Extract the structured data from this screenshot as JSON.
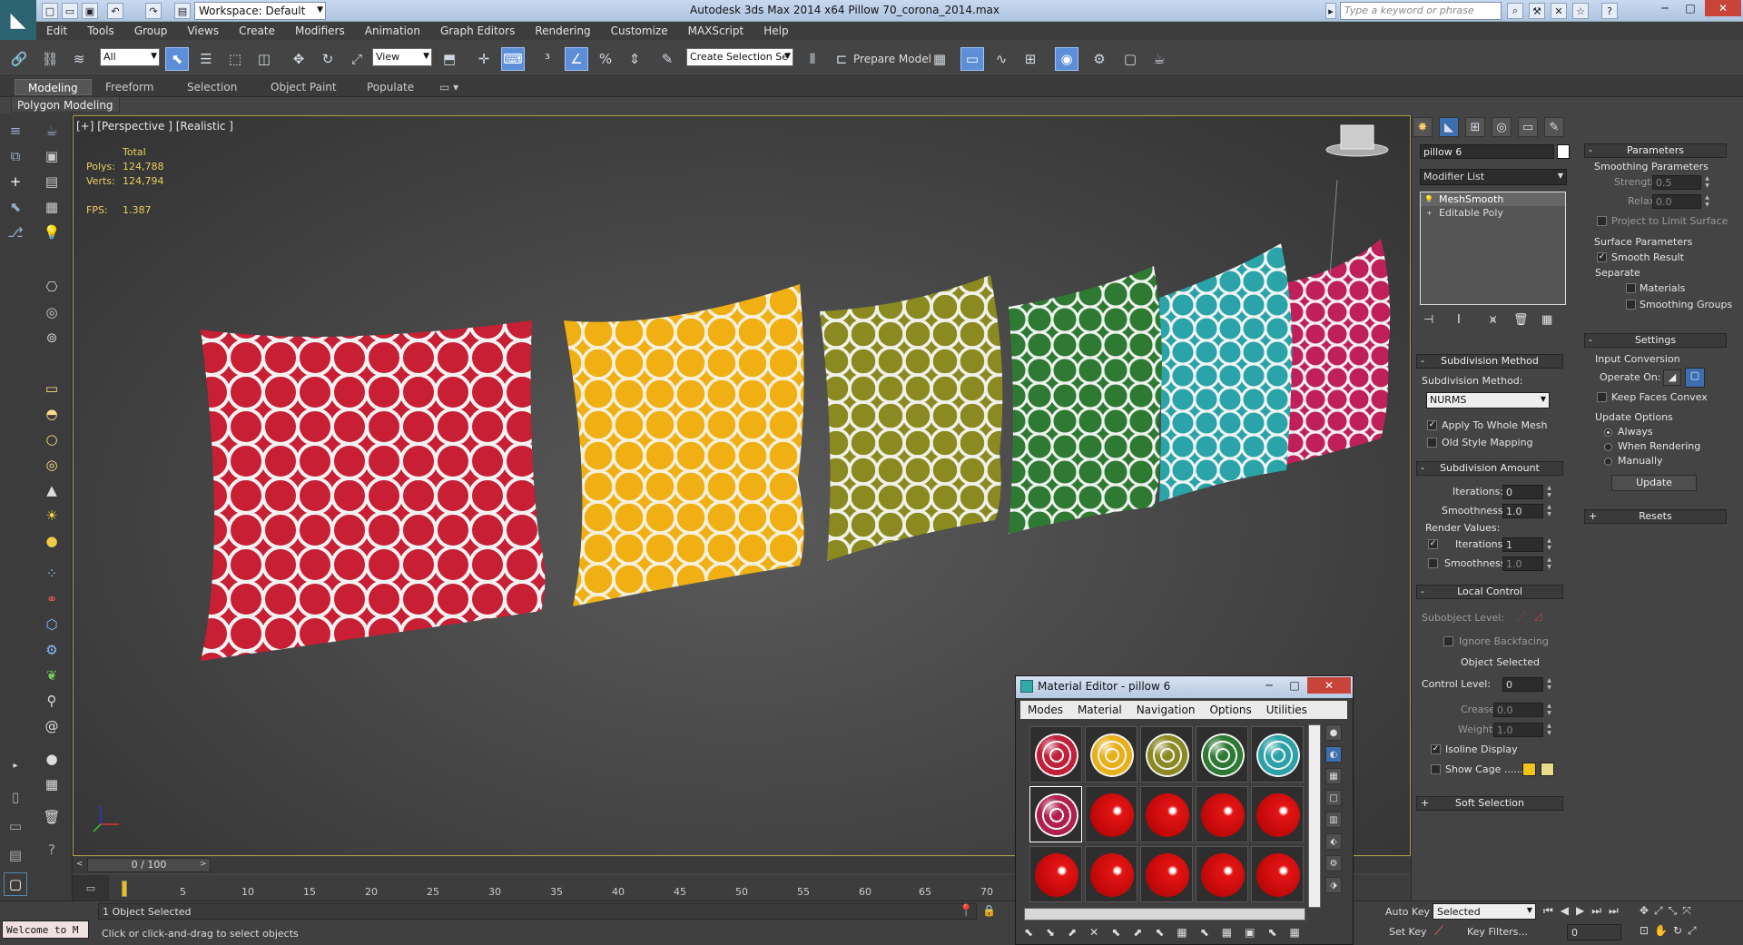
{
  "window": {
    "title": "Autodesk 3ds Max  2014 x64     Pillow 70_corona_2014.max",
    "workspace": "Workspace: Default",
    "search_placeholder": "Type a keyword or phrase"
  },
  "menu": [
    "Edit",
    "Tools",
    "Group",
    "Views",
    "Create",
    "Modifiers",
    "Animation",
    "Graph Editors",
    "Rendering",
    "Customize",
    "MAXScript",
    "Help"
  ],
  "toolbar": {
    "selection_filter": "All",
    "ref_coord": "View",
    "named_selection": "Create Selection Se",
    "prepare_model": "Prepare Model"
  },
  "ribbon": {
    "tabs": [
      "Modeling",
      "Freeform",
      "Selection",
      "Object Paint",
      "Populate"
    ],
    "active": "Modeling",
    "panel": "Polygon Modeling"
  },
  "viewport": {
    "label": "[+] [Perspective ] [Realistic ]",
    "stats": {
      "total_label": "Total",
      "polys_label": "Polys:",
      "polys": "124,788",
      "verts_label": "Verts:",
      "verts": "124,794",
      "fps_label": "FPS:",
      "fps": "1.387"
    },
    "pillow_colors": [
      "#c81f35",
      "#f0b014",
      "#8a8a20",
      "#2f7a32",
      "#2aa4a8",
      "#c0205a"
    ]
  },
  "command_panel": {
    "object_name": "pillow 6",
    "modifier_list": "Modifier List",
    "stack": [
      "MeshSmooth",
      "Editable Poly"
    ],
    "subdivision_method": {
      "header": "Subdivision Method",
      "label": "Subdivision Method:",
      "value": "NURMS",
      "apply_whole_mesh": "Apply To Whole Mesh",
      "old_style_mapping": "Old Style Mapping"
    },
    "subdivision_amount": {
      "header": "Subdivision Amount",
      "iterations_label": "Iterations:",
      "iterations": "0",
      "smoothness_label": "Smoothness:",
      "smoothness": "1.0",
      "render_values": "Render Values:",
      "r_iterations_label": "Iterations:",
      "r_iterations": "1",
      "r_smoothness_label": "Smoothness:",
      "r_smoothness": "1.0"
    },
    "local_control": {
      "header": "Local Control",
      "subobject_level": "Subobject Level:",
      "ignore_backfacing": "Ignore Backfacing",
      "object_selected": "Object Selected",
      "control_level_label": "Control Level:",
      "control_level": "0",
      "crease_label": "Crease:",
      "crease": "0.0",
      "weight_label": "Weight:",
      "weight": "1.0",
      "isoline_display": "Isoline Display",
      "show_cage": "Show Cage ......",
      "cage_colors": [
        "#f2c31a",
        "#e8dc8a"
      ]
    },
    "soft_selection": "Soft Selection",
    "parameters": {
      "header": "Parameters",
      "smoothing_params": "Smoothing Parameters",
      "strength_label": "Strength:",
      "strength": "0.5",
      "relax_label": "Relax:",
      "relax": "0.0",
      "project_limit": "Project to Limit Surface",
      "surface_params": "Surface Parameters",
      "smooth_result": "Smooth Result",
      "separate": "Separate",
      "materials": "Materials",
      "smoothing_groups": "Smoothing Groups"
    },
    "settings": {
      "header": "Settings",
      "input_conversion": "Input Conversion",
      "operate_on": "Operate On:",
      "keep_faces_convex": "Keep Faces Convex",
      "update_options": "Update Options",
      "always": "Always",
      "when_rendering": "When Rendering",
      "manually": "Manually",
      "update_button": "Update"
    },
    "resets": "Resets"
  },
  "timeline": {
    "frame": "0 / 100",
    "ticks": [
      "5",
      "10",
      "15",
      "20",
      "25",
      "30",
      "35",
      "40",
      "45",
      "50",
      "55",
      "60",
      "65",
      "70"
    ]
  },
  "status": {
    "welcome": "Welcome to M",
    "selection": "1 Object Selected",
    "prompt": "Click or click-and-drag to select objects",
    "auto_key": "Auto Key",
    "selected": "Selected",
    "set_key": "Set Key",
    "key_filters": "Key Filters...",
    "frame_field": "0"
  },
  "material_editor": {
    "title": "Material Editor - pillow 6",
    "menu": [
      "Modes",
      "Material",
      "Navigation",
      "Options",
      "Utilities"
    ],
    "slot_colors": [
      "#c0203a",
      "#e8b018",
      "#8a8a22",
      "#2e7a34",
      "#2aa2a8",
      "#b0204e",
      "#e41414",
      "#e41414",
      "#e41414",
      "#e41414",
      "#e41414",
      "#e41414",
      "#e41414",
      "#e41414",
      "#e41414"
    ]
  }
}
